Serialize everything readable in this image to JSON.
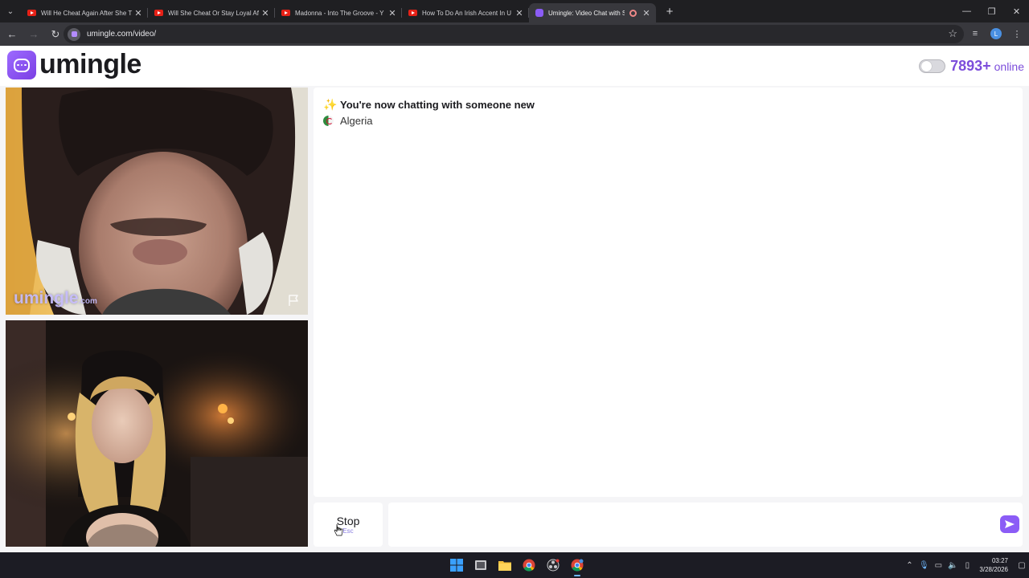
{
  "browser": {
    "tabs": [
      {
        "title": "Will He Cheat Again After She T",
        "icon": "youtube-icon"
      },
      {
        "title": "Will She Cheat Or Stay Loyal Af",
        "icon": "youtube-icon"
      },
      {
        "title": "Madonna - Into The Groove - Y",
        "icon": "youtube-icon"
      },
      {
        "title": "How To Do An Irish Accent In U",
        "icon": "youtube-icon"
      },
      {
        "title": "Umingle: Video Chat with S",
        "icon": "umingle-icon",
        "active": true
      }
    ],
    "url": "umingle.com/video/",
    "profile_initial": "L"
  },
  "header": {
    "logo_text": "umingle",
    "online_count": "7893+",
    "online_label": "online"
  },
  "stranger_video": {
    "watermark": "umingle",
    "watermark_suffix": ".com"
  },
  "chat": {
    "system_message": "You're now chatting with someone new",
    "country": "Algeria"
  },
  "controls": {
    "stop_label": "Stop",
    "stop_shortcut": "Esc",
    "message_placeholder": ""
  },
  "taskbar": {
    "time": "03:27",
    "date": "3/28/2026"
  },
  "colors": {
    "accent": "#7c4ddb",
    "brand_gradient_start": "#9d6bff",
    "brand_gradient_end": "#7b3fe4"
  }
}
